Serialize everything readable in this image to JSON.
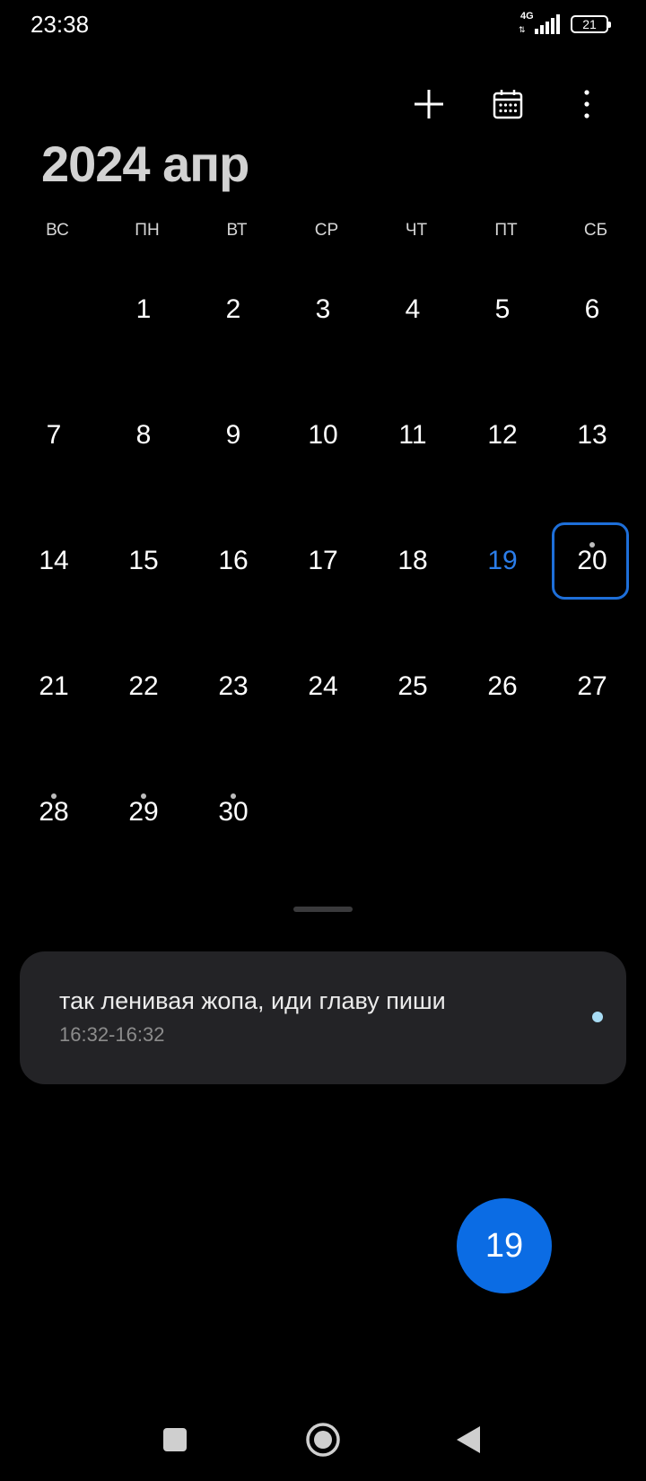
{
  "status_bar": {
    "time": "23:38",
    "network": "4G",
    "battery": "21"
  },
  "toolbar": {
    "icons": [
      "plus-icon",
      "calendar-grid-icon",
      "more-vertical-icon"
    ]
  },
  "header": {
    "title": "2024 апр"
  },
  "weekdays": [
    "ВС",
    "ПН",
    "ВТ",
    "СР",
    "ЧТ",
    "ПТ",
    "СБ"
  ],
  "calendar": {
    "today": "19",
    "selected": "20",
    "days_with_events": [
      "20",
      "28",
      "29",
      "30"
    ],
    "weeks": [
      [
        "",
        "1",
        "2",
        "3",
        "4",
        "5",
        "6"
      ],
      [
        "7",
        "8",
        "9",
        "10",
        "11",
        "12",
        "13"
      ],
      [
        "14",
        "15",
        "16",
        "17",
        "18",
        "19",
        "20"
      ],
      [
        "21",
        "22",
        "23",
        "24",
        "25",
        "26",
        "27"
      ],
      [
        "28",
        "29",
        "30",
        "",
        "",
        "",
        ""
      ]
    ]
  },
  "event": {
    "title": "так ленивая жопа, иди главу пиши",
    "time": "16:32-16:32",
    "color": "#a8dcf4"
  },
  "fab": {
    "label": "19"
  },
  "colors": {
    "accent": "#0b6ce4",
    "today_text": "#2b7de9",
    "selected_border": "#1e6fd9",
    "card_bg": "#232326"
  },
  "nav_bar": {
    "icons": [
      "recents-icon",
      "home-icon",
      "back-icon"
    ]
  }
}
